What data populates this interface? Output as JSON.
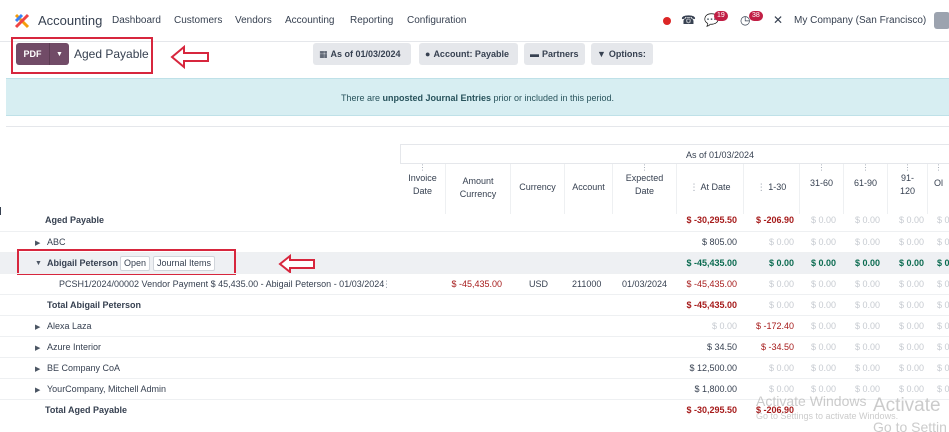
{
  "navbar": {
    "app_name": "Accounting",
    "menu": [
      "Dashboard",
      "Customers",
      "Vendors",
      "Accounting",
      "Reporting",
      "Configuration"
    ],
    "chat_badge": "19",
    "activity_badge": "38",
    "company": "My Company (San Francisco)"
  },
  "control": {
    "pdf_label": "PDF",
    "title": "Aged Payable",
    "filters": {
      "date": "As of 01/03/2024",
      "account": "Account: Payable",
      "partners": "Partners",
      "options": "Options:"
    }
  },
  "alert": {
    "prefix": "There are ",
    "bold": "unposted Journal Entries",
    "suffix": " prior or included in this period."
  },
  "report": {
    "period_header": "As of 01/03/2024",
    "columns": {
      "invoice_date": [
        "Invoice",
        "Date"
      ],
      "amount_currency": [
        "Amount",
        "Currency"
      ],
      "currency": "Currency",
      "account": "Account",
      "expected_date": [
        "Expected",
        "Date"
      ],
      "at_date": "At Date",
      "d1_30": "1-30",
      "d31_60": "31-60",
      "d61_90": "61-90",
      "d91_120": [
        "91-",
        "120"
      ],
      "older": "Ol"
    },
    "rows": {
      "aged_payable": {
        "label": "Aged Payable",
        "at_date": "$ -30,295.50",
        "d1_30": "$ -206.90",
        "d31_60": "$ 0.00",
        "d61_90": "$ 0.00",
        "d91_120": "$ 0.00",
        "older": "$ 0.0"
      },
      "abc": {
        "label": "ABC",
        "at_date": "$ 805.00",
        "d1_30": "$ 0.00",
        "d31_60": "$ 0.00",
        "d61_90": "$ 0.00",
        "d91_120": "$ 0.00",
        "older": "$ 0.0"
      },
      "abigail": {
        "label": "Abigail Peterson",
        "open_btn": "Open",
        "journal_btn": "Journal Items",
        "at_date": "$ -45,435.00",
        "d1_30": "$ 0.00",
        "d31_60": "$ 0.00",
        "d61_90": "$ 0.00",
        "d91_120": "$ 0.00",
        "older": "$ 0.0"
      },
      "abigail_line": {
        "label": "PCSH1/2024/00002 Vendor Payment $ 45,435.00 - Abigail Peterson - 01/03/2024",
        "amount_currency": "$ -45,435.00",
        "currency": "USD",
        "account": "211000",
        "expected_date": "01/03/2024",
        "at_date": "$ -45,435.00",
        "d1_30": "$ 0.00",
        "d31_60": "$ 0.00",
        "d61_90": "$ 0.00",
        "d91_120": "$ 0.00",
        "older": "$ 0.0"
      },
      "total_abigail": {
        "label": "Total Abigail Peterson",
        "at_date": "$ -45,435.00",
        "d1_30": "$ 0.00",
        "d31_60": "$ 0.00",
        "d61_90": "$ 0.00",
        "d91_120": "$ 0.00",
        "older": "$ 0.0"
      },
      "alexa": {
        "label": "Alexa Laza",
        "at_date": "$ 0.00",
        "d1_30": "$ -172.40",
        "d31_60": "$ 0.00",
        "d61_90": "$ 0.00",
        "d91_120": "$ 0.00",
        "older": "$ 0.0"
      },
      "azure": {
        "label": "Azure Interior",
        "at_date": "$ 34.50",
        "d1_30": "$ -34.50",
        "d31_60": "$ 0.00",
        "d61_90": "$ 0.00",
        "d91_120": "$ 0.00",
        "older": "$ 0.0"
      },
      "be_company": {
        "label": "BE Company CoA",
        "at_date": "$ 12,500.00",
        "d1_30": "$ 0.00",
        "d31_60": "$ 0.00",
        "d61_90": "$ 0.00",
        "d91_120": "$ 0.00",
        "older": "$ 0.0"
      },
      "yourcompany": {
        "label": "YourCompany, Mitchell Admin",
        "at_date": "$ 1,800.00",
        "d1_30": "$ 0.00",
        "d31_60": "$ 0.00",
        "d61_90": "$ 0.00",
        "d91_120": "$ 0.00",
        "older": "$ 0.0"
      },
      "total": {
        "label": "Total Aged Payable",
        "at_date": "$ -30,295.50",
        "d1_30": "$ -206.90"
      }
    }
  },
  "watermark": {
    "line1": "Activate Windows",
    "line2": "Go to Settings to activate Windows.",
    "line3": "Activate",
    "line4": "Go to Settin"
  },
  "colors": {
    "brand": "#714B67",
    "annotation": "#d7263d",
    "negative": "#a61b1b",
    "alert_bg": "#d7eef2"
  }
}
